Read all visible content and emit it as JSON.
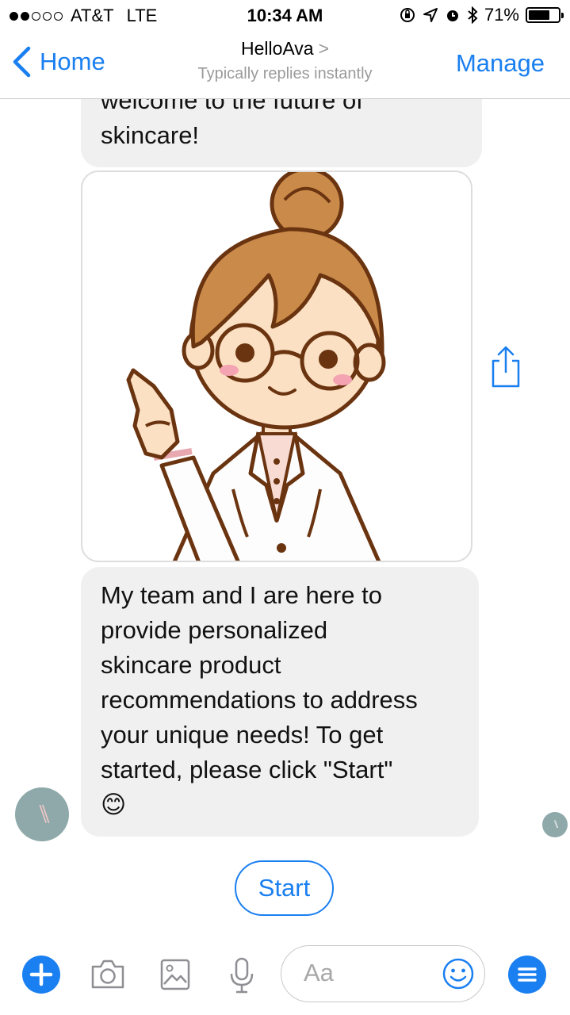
{
  "status_bar": {
    "carrier": "AT&T",
    "network": "LTE",
    "time": "10:34 AM",
    "battery": "71%",
    "battery_level": 0.71,
    "signal_bars": 2
  },
  "nav": {
    "back_label": "Home",
    "title": "HelloAva",
    "title_chevron": ">",
    "subtitle": "Typically replies instantly",
    "manage_label": "Manage"
  },
  "chat": {
    "messages": [
      {
        "text_lines": [
          "welcome to the future of",
          "skincare!"
        ]
      },
      {
        "text_lines": [
          "My team and I are here to",
          "provide personalized",
          "skincare product",
          "recommendations to address",
          "your unique needs! To get",
          "started, please click \"Start\"",
          "😊"
        ]
      }
    ],
    "avatar_initials": "\\\\",
    "quick_reply": "Start"
  },
  "composer": {
    "placeholder": "Aa",
    "icons": [
      "plus-icon",
      "camera-icon",
      "gallery-icon",
      "microphone-icon",
      "emoji-icon",
      "menu-icon"
    ]
  },
  "colors": {
    "accent": "#1a7ff0",
    "bubble": "#f1f0f0",
    "avatar": "#8fa9aa"
  }
}
